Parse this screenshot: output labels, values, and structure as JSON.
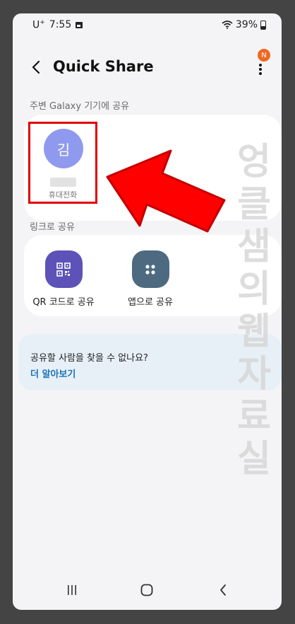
{
  "status_bar": {
    "carrier": "U",
    "carrier_plus": "+",
    "time": "7:55",
    "battery": "39%"
  },
  "header": {
    "title": "Quick Share",
    "notification_badge": "N",
    "badge_color": "#f06722"
  },
  "nearby": {
    "section_label": "주변 Galaxy 기기에 공유",
    "contact": {
      "initial": "김",
      "device_type": "휴대전화",
      "avatar_color": "#8f9aee"
    }
  },
  "link_share": {
    "section_label": "링크로 공유",
    "buttons": [
      {
        "label": "QR 코드로 공유",
        "icon": "qr-code-icon",
        "color": "#5c52b8"
      },
      {
        "label": "앱으로 공유",
        "icon": "apps-icon",
        "color": "#4d6a80"
      }
    ]
  },
  "help": {
    "question": "공유할 사람을 찾을 수 없나요?",
    "link": "더 알아보기"
  },
  "watermark": "엉클샘의웹자료실",
  "nav": {
    "icons": [
      "recent-apps-icon",
      "home-icon",
      "back-icon"
    ]
  }
}
